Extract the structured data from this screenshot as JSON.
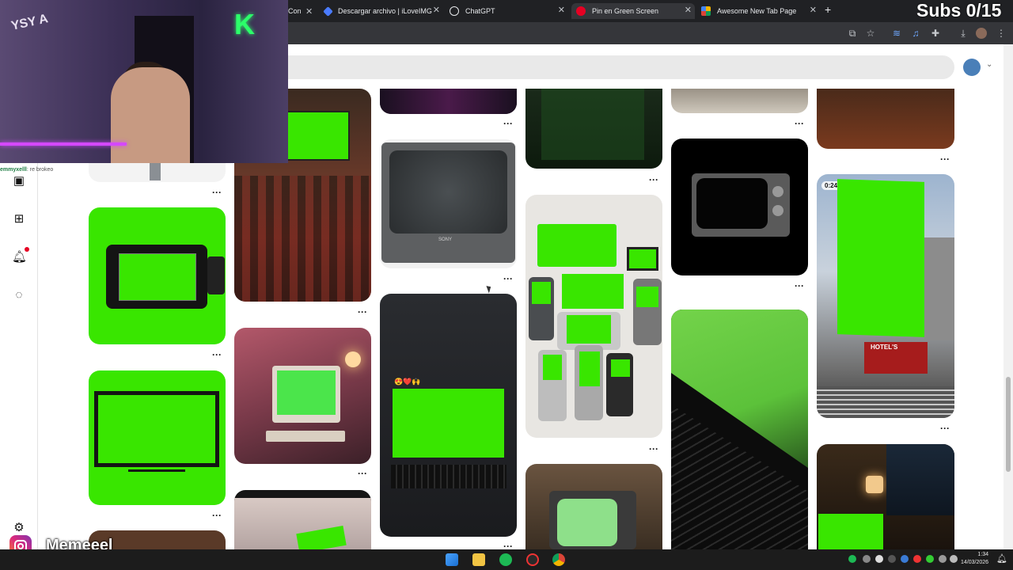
{
  "browser": {
    "tabs": [
      {
        "title": "Con",
        "icon_color": "#d9d9d9",
        "active": false
      },
      {
        "title": "Descargar archivo | iLoveIMG",
        "icon_color": "#4a7bff",
        "active": false
      },
      {
        "title": "ChatGPT",
        "icon_color": "#e8eaed",
        "active": false
      },
      {
        "title": "Pin en Green Screen",
        "icon_color": "#e60023",
        "active": true
      },
      {
        "title": "Awesome New Tab Page",
        "icon_color": "#f4b400",
        "active": false
      }
    ],
    "close_glyph": "✕",
    "new_tab_glyph": "+"
  },
  "overlay": {
    "subs_counter": "Subs 0/15",
    "chat_user": "emmyxelll",
    "chat_text": ": re brokeo",
    "instagram_handle": "Memeeel"
  },
  "pinterest": {
    "sidebar_icons": [
      "board-icon",
      "create-icon",
      "notifications-icon",
      "messages-icon",
      "settings-icon"
    ],
    "notification_color": "#e60023",
    "more_glyph": "···",
    "video_duration": "0:24",
    "billboard_sign": "HOTEL'S",
    "tv_brand": "SONY",
    "emoji_row": "😍❤️🙌"
  },
  "taskbar": {
    "time": "1:34",
    "date": "14/03/2026"
  },
  "colors": {
    "green_screen": "#39e600",
    "tab_bar": "#202124",
    "toolbar": "#35363a",
    "taskbar": "#1c1c1c"
  }
}
